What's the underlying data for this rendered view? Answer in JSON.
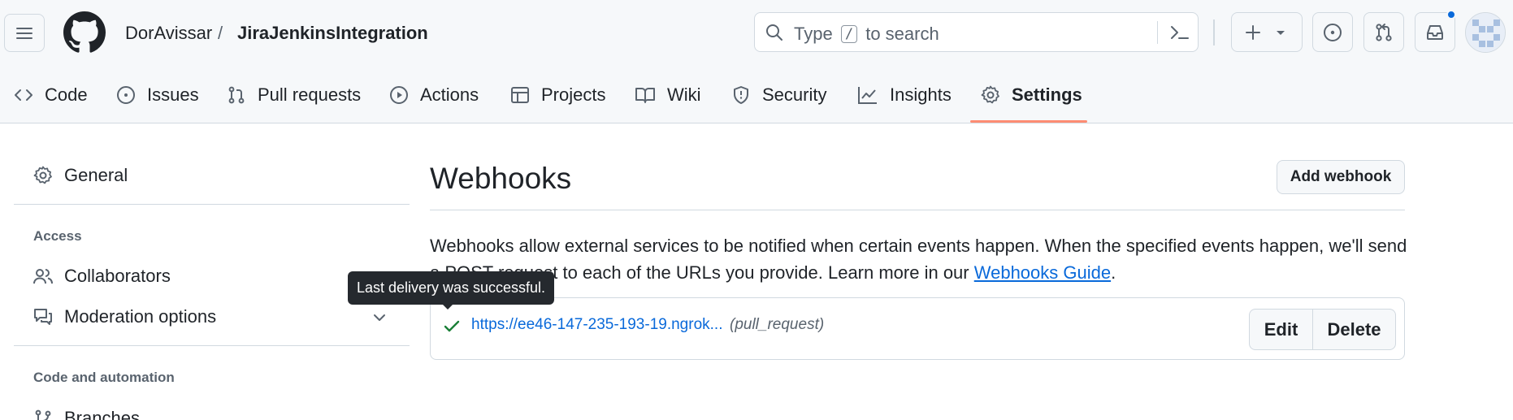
{
  "header": {
    "owner": "DorAvissar",
    "separator": "/",
    "repo": "JiraJenkinsIntegration",
    "search": {
      "prefix": "Type",
      "key": "/",
      "suffix": "to search"
    },
    "icons": [
      "hamburger-icon",
      "github-logo",
      "search-icon",
      "command-palette-icon",
      "plus-icon",
      "triangle-down-icon",
      "issue-opened-icon",
      "git-pull-request-icon",
      "inbox-icon",
      "avatar"
    ]
  },
  "repo_nav": {
    "tabs": [
      {
        "label": "Code",
        "icon": "code-icon"
      },
      {
        "label": "Issues",
        "icon": "issue-opened-icon"
      },
      {
        "label": "Pull requests",
        "icon": "git-pull-request-icon"
      },
      {
        "label": "Actions",
        "icon": "play-icon"
      },
      {
        "label": "Projects",
        "icon": "table-icon"
      },
      {
        "label": "Wiki",
        "icon": "book-icon"
      },
      {
        "label": "Security",
        "icon": "shield-icon"
      },
      {
        "label": "Insights",
        "icon": "graph-icon"
      },
      {
        "label": "Settings",
        "icon": "gear-icon",
        "selected": true
      }
    ],
    "selected_color": "#fd8c73"
  },
  "sidebar": {
    "general": "General",
    "access_heading": "Access",
    "collaborators": "Collaborators",
    "moderation": "Moderation options",
    "code_heading": "Code and automation",
    "branches": "Branches"
  },
  "main": {
    "title": "Webhooks",
    "add_button": "Add webhook",
    "description": "Webhooks allow external services to be notified when certain events happen. When the specified events happen, we'll send a POST request to each of the URLs you provide. Learn more in our ",
    "guide_link": "Webhooks Guide",
    "description_end": ".",
    "webhook": {
      "url": "https://ee46-147-235-193-19.ngrok...",
      "events": "(pull_request)",
      "status": "success",
      "status_color": "#1a7f37",
      "edit_label": "Edit",
      "delete_label": "Delete"
    },
    "tooltip": "Last delivery was successful."
  },
  "colors": {
    "link": "#0969da",
    "header_bg": "#f6f8fa",
    "border": "#d1d9e0",
    "accent_dot": "#0969da"
  }
}
